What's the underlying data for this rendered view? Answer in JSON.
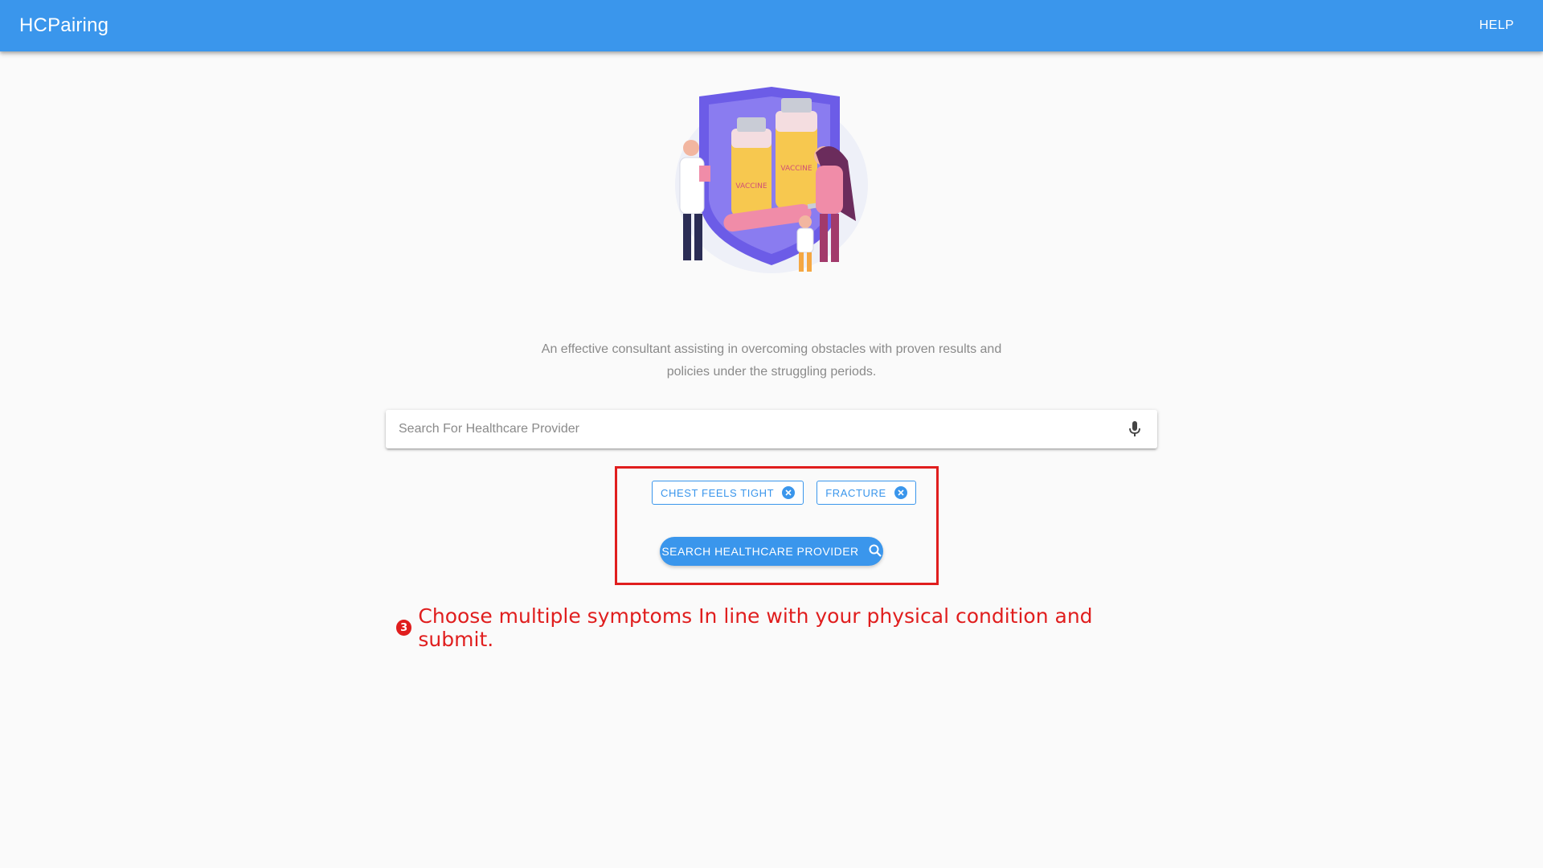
{
  "appbar": {
    "title": "HCPairing",
    "help_label": "HELP"
  },
  "hero": {
    "illustration_icon": "vaccine-illustration",
    "vial_label_1": "VACCINE",
    "vial_label_2": "VACCINE"
  },
  "tagline": {
    "line1": "An effective consultant assisting in overcoming obstacles with proven results and",
    "line2": "policies under the struggling periods."
  },
  "search": {
    "placeholder": "Search For Healthcare Provider",
    "value": "",
    "mic_icon": "mic-icon"
  },
  "symptoms": [
    {
      "label": "CHEST FEELS TIGHT",
      "remove_icon": "close-circle-icon"
    },
    {
      "label": "FRACTURE",
      "remove_icon": "close-circle-icon"
    }
  ],
  "search_button": {
    "label": "SEARCH HEALTHCARE PROVIDER",
    "icon": "search-icon"
  },
  "instruction": {
    "step": "3",
    "text": "Choose multiple symptoms In line with your physical condition and submit."
  },
  "colors": {
    "primary": "#3a96ec",
    "annotation_red": "#e01e1e",
    "background": "#fafafa"
  }
}
